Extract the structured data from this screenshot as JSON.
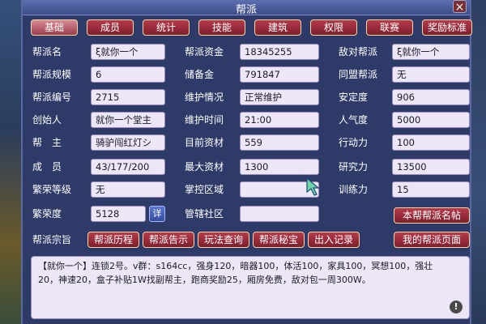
{
  "window": {
    "title": "帮派",
    "close_glyph": "×"
  },
  "tabs": [
    {
      "label": "基础",
      "active": true
    },
    {
      "label": "成员"
    },
    {
      "label": "统计"
    },
    {
      "label": "技能"
    },
    {
      "label": "建筑"
    },
    {
      "label": "权限"
    },
    {
      "label": "联赛"
    },
    {
      "label": "奖励标准"
    }
  ],
  "col1": [
    {
      "label": "帮派名",
      "value": "ξ就你一个"
    },
    {
      "label": "帮派规模",
      "value": "6"
    },
    {
      "label": "帮派编号",
      "value": "2715"
    },
    {
      "label": "创始人",
      "value": "就你一个堂主"
    },
    {
      "label": "帮　主",
      "value": "骑驴闯红灯シ"
    },
    {
      "label": "成　员",
      "value": "43/177/200"
    },
    {
      "label": "繁荣等级",
      "value": "无"
    },
    {
      "label": "繁荣度",
      "value": "5128"
    }
  ],
  "col1_detail_button": "详",
  "col2": [
    {
      "label": "帮派资金",
      "value": "18345255"
    },
    {
      "label": "储备金",
      "value": "791847"
    },
    {
      "label": "维护情况",
      "value": "正常维护"
    },
    {
      "label": "维护时间",
      "value": "21:00"
    },
    {
      "label": "目前资材",
      "value": "559"
    },
    {
      "label": "最大资材",
      "value": "1300"
    },
    {
      "label": "掌控区域",
      "value": ""
    },
    {
      "label": "管辖社区",
      "value": ""
    }
  ],
  "col3": [
    {
      "label": "敌对帮派",
      "value": "ξ就你一个"
    },
    {
      "label": "同盟帮派",
      "value": "无"
    },
    {
      "label": "安定度",
      "value": "906"
    },
    {
      "label": "人气度",
      "value": "5000"
    },
    {
      "label": "行动力",
      "value": "100"
    },
    {
      "label": "研究力",
      "value": "13500"
    },
    {
      "label": "训练力",
      "value": "15"
    }
  ],
  "name_card_button": "本帮帮派名帖",
  "tenet_label": "帮派宗旨",
  "action_buttons": [
    "帮派历程",
    "帮派告示",
    "玩法查询",
    "帮派秘宝",
    "出入记录"
  ],
  "my_page_button": "我的帮派页面",
  "description": "【就你一个】连锁2号。v群：s164cc，强身120，暗器100，体活100，家具100，冥想100，强壮20，神速20，盒子补贴1W找副帮主，跑商奖励25，厢房免费，敌对包一周300W。",
  "info_glyph": "!"
}
